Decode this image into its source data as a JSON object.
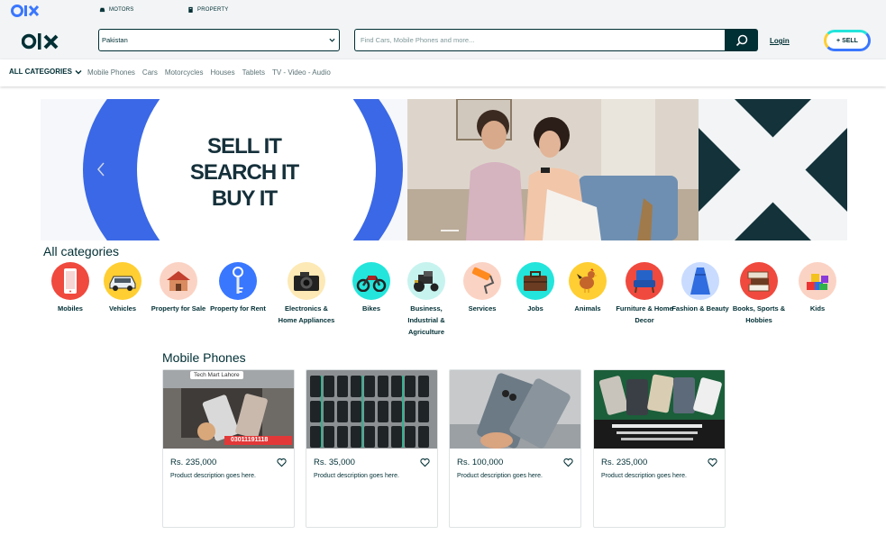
{
  "top_nav": {
    "motors": "MOTORS",
    "property": "PROPERTY"
  },
  "header": {
    "location_value": "Pakistan",
    "search_placeholder": "Find Cars, Mobile Phones and more...",
    "login_label": "Login",
    "sell_label": "+ SELL"
  },
  "category_bar": {
    "all_categories_label": "ALL CATEGORIES",
    "links": [
      "Mobile Phones",
      "Cars",
      "Motorcycles",
      "Houses",
      "Tablets",
      "TV - Video - Audio"
    ]
  },
  "banner": {
    "line1": "SELL IT",
    "line2": "SEARCH IT",
    "line3": "BUY IT"
  },
  "all_categories": {
    "title": "All categories",
    "items": [
      {
        "label": "Mobiles",
        "icon": "mobile-phone-icon",
        "bg": "#f0493e"
      },
      {
        "label": "Vehicles",
        "icon": "car-icon",
        "bg": "#ffce32"
      },
      {
        "label": "Property for Sale",
        "icon": "house-icon",
        "bg": "#fbd3c4"
      },
      {
        "label": "Property for Rent",
        "icon": "key-icon",
        "bg": "#3a77ff"
      },
      {
        "label": "Electronics & Home Appliances",
        "icon": "camera-icon",
        "bg": "#fde9b5"
      },
      {
        "label": "Bikes",
        "icon": "motorbike-icon",
        "bg": "#23e5db"
      },
      {
        "label": "Business, Industrial & Agriculture",
        "icon": "tractor-icon",
        "bg": "#c7f3ef"
      },
      {
        "label": "Services",
        "icon": "paint-roller-icon",
        "bg": "#fbd3c4"
      },
      {
        "label": "Jobs",
        "icon": "briefcase-icon",
        "bg": "#23e5db"
      },
      {
        "label": "Animals",
        "icon": "rooster-icon",
        "bg": "#ffce32"
      },
      {
        "label": "Furniture & Home Decor",
        "icon": "armchair-icon",
        "bg": "#f0493e"
      },
      {
        "label": "Fashion & Beauty",
        "icon": "dress-icon",
        "bg": "#c9dcff"
      },
      {
        "label": "Books, Sports & Hobbies",
        "icon": "books-icon",
        "bg": "#f0493e"
      },
      {
        "label": "Kids",
        "icon": "toy-blocks-icon",
        "bg": "#fbd3c4"
      }
    ]
  },
  "mobile_phones": {
    "title": "Mobile Phones",
    "cards": [
      {
        "price": "Rs. 235,000",
        "desc": "Product description goes here.",
        "img_text_top": "Tech Mart Lahore",
        "img_text_bottom": "03011191118"
      },
      {
        "price": "Rs. 35,000",
        "desc": "Product description goes here.",
        "img_text_top": "",
        "img_text_bottom": ""
      },
      {
        "price": "Rs. 100,000",
        "desc": "Product description goes here.",
        "img_text_top": "",
        "img_text_bottom": ""
      },
      {
        "price": "Rs. 235,000",
        "desc": "Product description goes here.",
        "img_text_top": "",
        "img_text_bottom": ""
      }
    ]
  },
  "colors": {
    "brand_dark": "#002f34",
    "accent_blue": "#3a77ff",
    "accent_teal": "#23e5db",
    "accent_yellow": "#ffce32"
  }
}
